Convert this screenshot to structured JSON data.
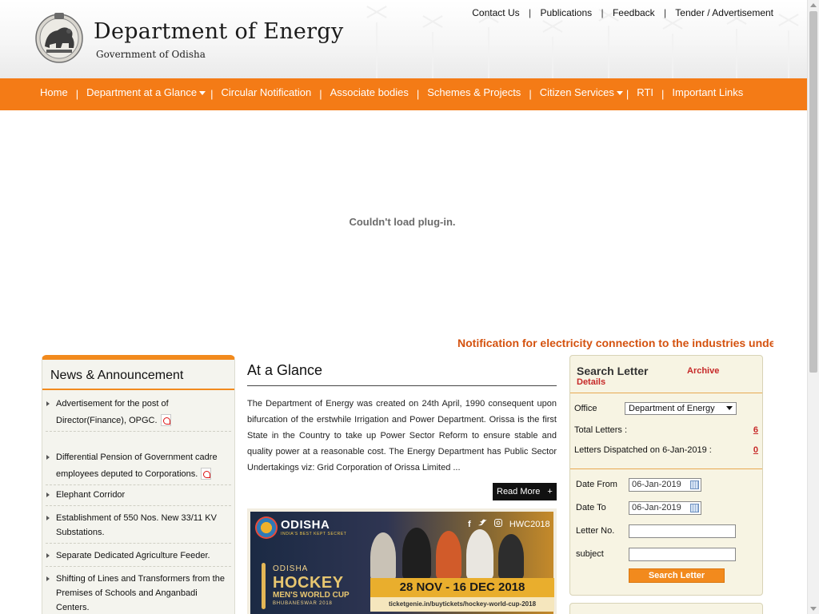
{
  "header": {
    "title": "Department of Energy",
    "subtitle": "Government of Odisha",
    "top_links": [
      "Contact Us",
      "Publications",
      "Feedback",
      "Tender / Advertisement"
    ]
  },
  "nav": {
    "items": [
      {
        "label": "Home",
        "dropdown": false
      },
      {
        "label": "Department at a Glance",
        "dropdown": true
      },
      {
        "label": "Circular Notification",
        "dropdown": false
      },
      {
        "label": "Associate bodies",
        "dropdown": false
      },
      {
        "label": "Schemes & Projects",
        "dropdown": false
      },
      {
        "label": "Citizen Services",
        "dropdown": true
      },
      {
        "label": "RTI",
        "dropdown": false
      },
      {
        "label": "Important Links",
        "dropdown": false
      }
    ],
    "accent_color": "#f47b16"
  },
  "plugin": {
    "message": "Couldn't load plug-in."
  },
  "marquee": {
    "text": "Notification for electricity connection to the industries unde"
  },
  "news": {
    "title": "News & Announcement",
    "items": [
      {
        "text": "Advertisement for the post of Director(Finance), OPGC.",
        "pdf": true
      },
      {
        "text": " Differential Pension of Government cadre employees deputed to Corporations.",
        "pdf": true
      },
      {
        "text": "Elephant Corridor",
        "pdf": false
      },
      {
        "text": "Establishment of 550 Nos. New 33/11 KV Substations.",
        "pdf": false
      },
      {
        "text": "Separate Dedicated Agriculture Feeder.",
        "pdf": false
      },
      {
        "text": "Shifting of Lines and Transformers from the Premises of Schools and Anganbadi Centers.",
        "pdf": false
      }
    ]
  },
  "glance": {
    "title": "At a Glance",
    "body": "The Department of Energy was created on 24th April, 1990 consequent upon bifurcation of the erstwhile Irrigation and Power Department. Orissa is the first State in the Country to take up Power Sector Reform to ensure stable and quality power at a reasonable cost. The Energy Department has Public Sector Undertakings viz: Grid Corporation of Orissa Limited ...",
    "read_more": "Read More",
    "read_more_icon": "+"
  },
  "banner": {
    "brand": "ODISHA",
    "tagline": "INDIA'S BEST KEPT SECRET",
    "hashtag": "HWC2018",
    "event_line1": "ODISHA",
    "event_line2": "HOCKEY",
    "event_line3": "MEN'S WORLD CUP",
    "event_line4": "BHUBANESWAR 2018",
    "dates": "28 NOV - 16 DEC 2018",
    "url": "ticketgenie.in/buytickets/hockey-world-cup-2018",
    "social_icons": [
      "facebook-icon",
      "twitter-icon",
      "instagram-icon"
    ]
  },
  "search": {
    "title": "Search Letter",
    "archive_label": "Archive",
    "details_label": "Details",
    "office_label": "Office",
    "office_value": "Department of Energy",
    "total_letters_label": "Total Letters :",
    "total_letters_value": "6",
    "dispatched_label": "Letters Dispatched on 6-Jan-2019 :",
    "dispatched_value": "0",
    "date_from_label": "Date From",
    "date_from_value": "06-Jan-2019",
    "date_to_label": "Date To",
    "date_to_value": "06-Jan-2019",
    "letter_no_label": "Letter No.",
    "subject_label": "subject",
    "button_label": "Search Letter"
  }
}
